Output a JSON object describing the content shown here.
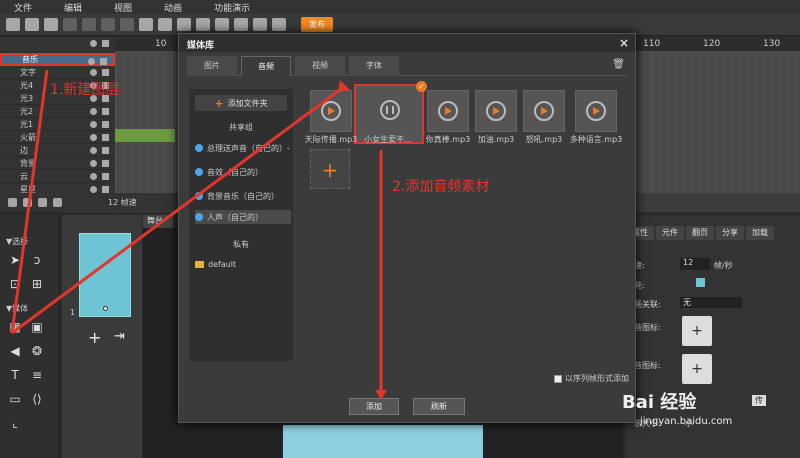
{
  "menu": [
    "文件",
    "编辑",
    "视图",
    "动画",
    "功能演示"
  ],
  "toolbar": {
    "publish_label": "发布"
  },
  "timeline": {
    "ruler": [
      "10",
      "110",
      "120",
      "130"
    ],
    "layers": [
      "音乐",
      "文字",
      "光4",
      "光3",
      "光2",
      "光1",
      "火箭",
      "边",
      "背景",
      "云",
      "星星"
    ],
    "fps_label": "12 帧速"
  },
  "tools": {
    "select_label": "选择",
    "media_label": "媒体"
  },
  "thumb_page_num": "1",
  "stage_tab": "舞台",
  "right_panel": {
    "tabs": [
      "属性",
      "元件",
      "翻页",
      "分享",
      "加载"
    ],
    "fps_label": "速:",
    "fps_value": "12",
    "fps_unit": "帧/秒",
    "fill_label": "充:",
    "link_label": "画关联:",
    "link_value": "无",
    "icon1_label": "音图标:",
    "icon2_label": "音图标:",
    "size_label": "示大小:",
    "size_value": "小",
    "upload": "传"
  },
  "dialog": {
    "title": "媒体库",
    "tabs": [
      "图片",
      "音频",
      "视频",
      "字体"
    ],
    "active_tab": "音频",
    "add_folder": "添加文件夹",
    "shared_group": "共享组",
    "shared_items": [
      "总理送声音（自己的）-",
      "音效（自己的）",
      "背景音乐（自己的）",
      "人声（自己的）"
    ],
    "private_group": "私有",
    "private_items": [
      "default"
    ],
    "assets": [
      "天际传播.mp3",
      "小女生爱不...",
      "你真棒.mp3",
      "加油.mp3",
      "怒吼.mp3",
      "多种语言.mp3"
    ],
    "sequence_label": "以序列帧形式添加",
    "add_button": "添加",
    "refresh_button": "刷新"
  },
  "annotations": {
    "step1": "1.新建图层",
    "step2": "2.添加音频素材"
  },
  "watermark": {
    "text": "Bai 经验",
    "url": "jingyan.baidu.com"
  },
  "colors": {
    "accent": "#f07a24",
    "highlight": "#e2352b",
    "stage_page": "#6ec4d4"
  }
}
